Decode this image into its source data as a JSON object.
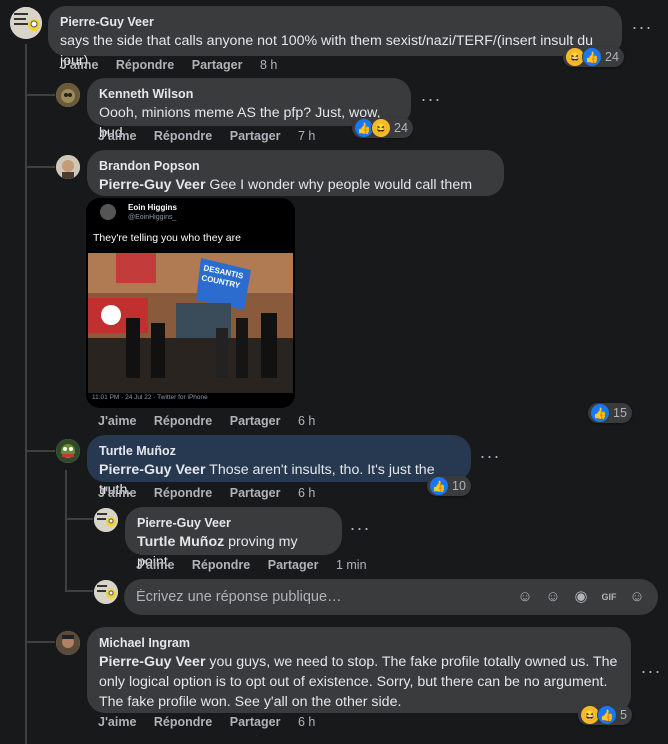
{
  "actions": {
    "like": "J'aime",
    "reply": "Répondre",
    "share": "Partager"
  },
  "comments": [
    {
      "author": "Pierre-Guy Veer",
      "text": "says the side that calls anyone not 100% with them sexist/nazi/TERF/(insert insult du jour)",
      "time": "8 h",
      "reactions": "24"
    },
    {
      "author": "Kenneth Wilson",
      "text": "Oooh, minions meme AS the pfp? Just, wow, bud",
      "time": "7 h",
      "reactions": "24"
    },
    {
      "author": "Brandon Popson",
      "mention": "Pierre-Guy Veer",
      "text": " Gee I wonder why people would call them that.",
      "time": "6 h",
      "reactions": "15",
      "embed": {
        "name": "Eoin Higgins",
        "handle": "@EoinHiggins_",
        "tweet": "They're telling you who they are",
        "sign": "DESANTIS COUNTRY",
        "footer": "11:01 PM · 24 Jul 22 · Twitter for iPhone"
      }
    },
    {
      "author": "Turtle Muñoz",
      "mention": "Pierre-Guy Veer",
      "text": " Those aren't insults, tho. It's just the truth.",
      "time": "6 h",
      "reactions": "10"
    },
    {
      "author": "Pierre-Guy Veer",
      "mention": "Turtle Muñoz",
      "text": " proving my point",
      "time": "1 min"
    },
    {
      "author": "Michael Ingram",
      "mention": "Pierre-Guy Veer",
      "text": " you guys, we need to stop. The fake profile totally owned us. The only logical option is to opt out of existence. Sorry, but there can be no argument. The fake profile won. See y'all on the other side.",
      "time": "6 h",
      "reactions": "5"
    }
  ],
  "reply_input": {
    "placeholder": "Écrivez une réponse publique…"
  },
  "icons": [
    "like-icon",
    "haha-icon",
    "more-options-icon",
    "sticker-icon",
    "emoji-icon",
    "camera-icon",
    "gif-icon",
    "avatar-sticker-icon"
  ],
  "colors": {
    "background": "#18191a",
    "bubble": "#3a3b3c",
    "highlight": "#263951",
    "like": "#1877f2",
    "haha": "#f7b928"
  }
}
